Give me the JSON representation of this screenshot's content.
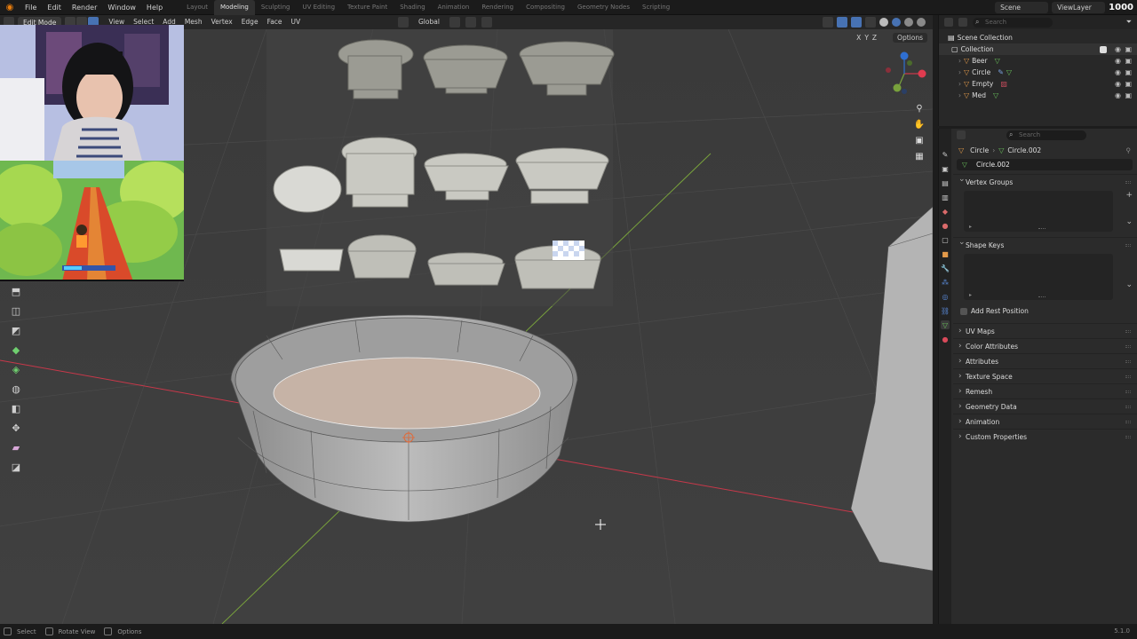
{
  "topbar": {
    "menus": [
      "File",
      "Edit",
      "Render",
      "Window",
      "Help"
    ],
    "workspaces": [
      "Layout",
      "Modeling",
      "Sculpting",
      "UV Editing",
      "Texture Paint",
      "Shading",
      "Animation",
      "Rendering",
      "Compositing",
      "Geometry Nodes",
      "Scripting"
    ],
    "active_workspace": "Modeling",
    "scene": "Scene",
    "view_layer": "ViewLayer",
    "stat": "1000"
  },
  "viewport_header": {
    "mode": "Edit Mode",
    "menus": [
      "View",
      "Select",
      "Add",
      "Mesh",
      "Vertex",
      "Edge",
      "Face",
      "UV"
    ],
    "transform_orientation": "Global",
    "axes": [
      "X",
      "Y",
      "Z"
    ],
    "options_label": "Options"
  },
  "outliner": {
    "search_placeholder": "Search",
    "root": "Scene Collection",
    "collection": "Collection",
    "objects": [
      {
        "name": "Beer",
        "icon": "mesh-object-icon",
        "data_color": "#69c05b"
      },
      {
        "name": "Circle",
        "icon": "mesh-object-icon",
        "data_color": "#69c05b"
      },
      {
        "name": "Empty",
        "icon": "empty-object-icon",
        "data_color": "#c04b5b"
      },
      {
        "name": "Med",
        "icon": "mesh-object-icon",
        "data_color": "#69c05b"
      }
    ]
  },
  "properties": {
    "search_placeholder": "Search",
    "breadcrumb_object": "Circle",
    "breadcrumb_data": "Circle.002",
    "mesh_name": "Circle.002",
    "panels": {
      "vertex_groups": "Vertex Groups",
      "shape_keys": "Shape Keys",
      "add_rest_position": "Add Rest Position",
      "collapsed": [
        "UV Maps",
        "Color Attributes",
        "Attributes",
        "Texture Space",
        "Remesh",
        "Geometry Data",
        "Animation",
        "Custom Properties"
      ]
    }
  },
  "statusbar": {
    "select": "Select",
    "rotate": "Rotate View",
    "options": "Options",
    "version": "5.1.0"
  },
  "colors": {
    "accent": "#4772b3",
    "blender_orange": "#e87d0d",
    "axis_x": "#c8384a",
    "axis_y": "#78a13c",
    "mesh_face": "#c6b3a6"
  }
}
